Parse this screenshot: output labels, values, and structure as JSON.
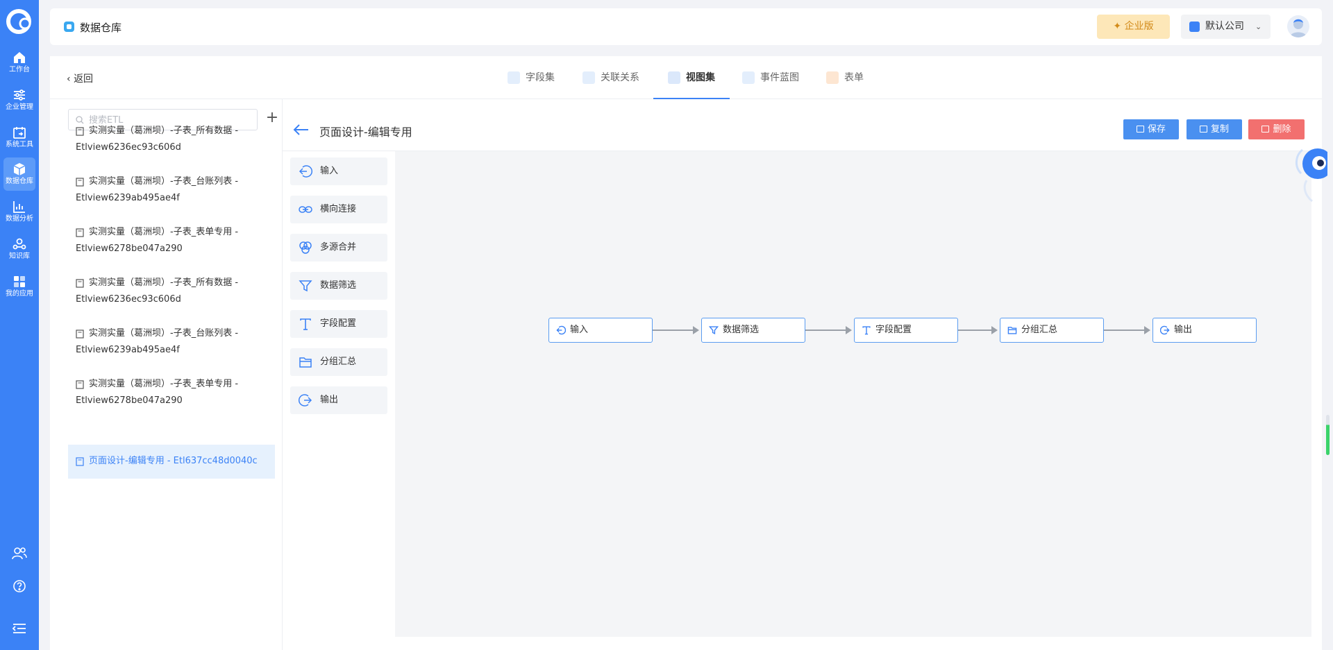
{
  "rail": {
    "items": [
      {
        "label": "工作台",
        "icon": "home-icon"
      },
      {
        "label": "企业管理",
        "icon": "sliders-icon"
      },
      {
        "label": "系统工具",
        "icon": "tools-icon"
      },
      {
        "label": "数据仓库",
        "icon": "cube-icon"
      },
      {
        "label": "数据分析",
        "icon": "chart-icon"
      },
      {
        "label": "知识库",
        "icon": "knowledge-icon"
      },
      {
        "label": "我的应用",
        "icon": "apps-icon"
      }
    ],
    "active": "数据仓库",
    "bottom_icons": [
      "users-icon",
      "help-icon",
      "collapse-menu-icon"
    ]
  },
  "header": {
    "title": "数据仓库",
    "enterprise_label": "企业版",
    "company": "默认公司"
  },
  "nav": {
    "back": "返回",
    "tabs": [
      {
        "label": "字段集"
      },
      {
        "label": "关联关系"
      },
      {
        "label": "视图集"
      },
      {
        "label": "事件蓝图"
      },
      {
        "label": "表单"
      }
    ],
    "active_tab": "视图集"
  },
  "etl": {
    "search_placeholder": "搜索ETL",
    "items": [
      {
        "line1": "实测实量（葛洲坝）-子表_所有数据 -",
        "line2": "Etlview6236ec93c606d"
      },
      {
        "line1": "实测实量（葛洲坝）-子表_台账列表 -",
        "line2": "Etlview6239ab495ae4f"
      },
      {
        "line1": "实测实量（葛洲坝）-子表_表单专用 -",
        "line2": "Etlview6278be047a290"
      },
      {
        "line1": "实测实量（葛洲坝）-子表_所有数据 -",
        "line2": "Etlview6236ec93c606d"
      },
      {
        "line1": "实测实量（葛洲坝）-子表_台账列表 -",
        "line2": "Etlview6239ab495ae4f"
      },
      {
        "line1": "实测实量（葛洲坝）-子表_表单专用 -",
        "line2": "Etlview6278be047a290"
      },
      {
        "line1": "页面设计-编辑专用 - Etl637cc48d0040c",
        "line2": ""
      }
    ],
    "active_index": 6
  },
  "editor": {
    "title": "页面设计-编辑专用",
    "save": "保存",
    "copy": "复制",
    "delete": "删除",
    "palette": [
      {
        "label": "输入",
        "icon": "input-icon"
      },
      {
        "label": "横向连接",
        "icon": "link-icon"
      },
      {
        "label": "多源合并",
        "icon": "merge-icon"
      },
      {
        "label": "数据筛选",
        "icon": "filter-icon"
      },
      {
        "label": "字段配置",
        "icon": "text-icon"
      },
      {
        "label": "分组汇总",
        "icon": "folder-icon"
      },
      {
        "label": "输出",
        "icon": "output-icon"
      }
    ],
    "flow": [
      {
        "label": "输入",
        "icon": "input-icon"
      },
      {
        "label": "数据筛选",
        "icon": "filter-icon"
      },
      {
        "label": "字段配置",
        "icon": "text-icon"
      },
      {
        "label": "分组汇总",
        "icon": "folder-icon"
      },
      {
        "label": "输出",
        "icon": "output-icon"
      }
    ]
  }
}
